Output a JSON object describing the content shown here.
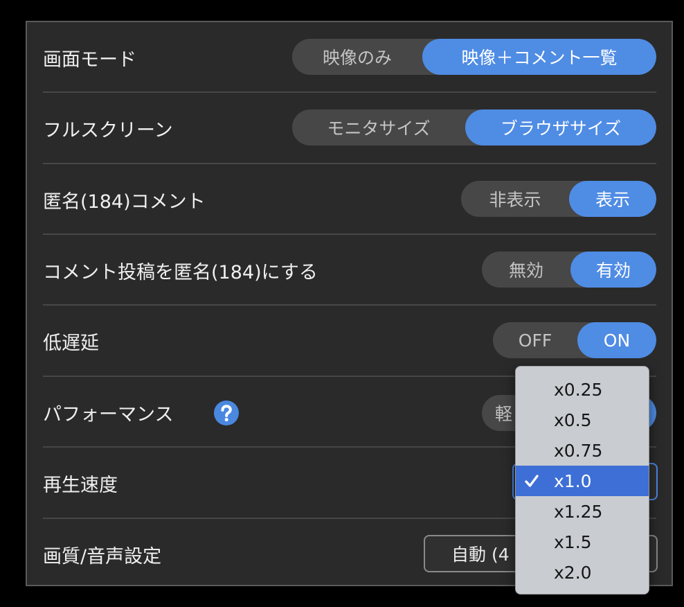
{
  "rows": {
    "screen_mode": {
      "label": "画面モード",
      "options": [
        "映像のみ",
        "映像＋コメント一覧"
      ],
      "selected_index": 1
    },
    "fullscreen": {
      "label": "フルスクリーン",
      "options": [
        "モニタサイズ",
        "ブラウザサイズ"
      ],
      "selected_index": 1
    },
    "anonymous_comments": {
      "label": "匿名(184)コメント",
      "options": [
        "非表示",
        "表示"
      ],
      "selected_index": 1
    },
    "anonymous_post": {
      "label": "コメント投稿を匿名(184)にする",
      "options": [
        "無効",
        "有効"
      ],
      "selected_index": 1
    },
    "low_latency": {
      "label": "低遅延",
      "options": [
        "OFF",
        "ON"
      ],
      "selected_index": 1
    },
    "performance": {
      "label": "パフォーマンス",
      "help_icon": "question-icon",
      "options": [
        "軽"
      ],
      "selected_index": 1
    },
    "playback_speed": {
      "label": "再生速度"
    },
    "quality": {
      "label": "画質/音声設定",
      "value": "自動 (4"
    }
  },
  "speed_menu": {
    "items": [
      "x0.25",
      "x0.5",
      "x0.75",
      "x1.0",
      "x1.25",
      "x1.5",
      "x2.0"
    ],
    "selected_index": 3,
    "check_icon": "checkmark-icon"
  },
  "colors": {
    "accent": "#4f8ce4",
    "menu_highlight": "#3d6fd6",
    "panel_background": "#2a2a2a",
    "toggle_track": "#474747"
  }
}
